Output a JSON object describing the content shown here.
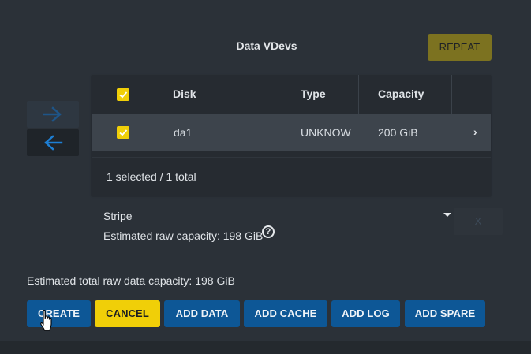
{
  "vdevs": {
    "title": "Data VDevs",
    "repeat_label": "REPEAT"
  },
  "table": {
    "columns": [
      "Disk",
      "Type",
      "Capacity"
    ],
    "rows": [
      {
        "disk": "da1",
        "type": "UNKNOW",
        "capacity": "200 GiB",
        "selected": true
      }
    ],
    "footer": "1 selected / 1 total"
  },
  "layout_type": {
    "value": "Stripe",
    "estimated": "Estimated raw capacity: 198 GiB",
    "help_glyph": "?",
    "remove_label": "X"
  },
  "summary": {
    "total": "Estimated total raw data capacity: 198 GiB"
  },
  "actions": {
    "create": "CREATE",
    "cancel": "CANCEL",
    "add_data": "ADD DATA",
    "add_cache": "ADD CACHE",
    "add_log": "ADD LOG",
    "add_spare": "ADD SPARE"
  },
  "colors": {
    "primary": "#0d5796",
    "accent": "#f0cf08",
    "repeat": "#7c7220",
    "background": "#2b3138"
  }
}
